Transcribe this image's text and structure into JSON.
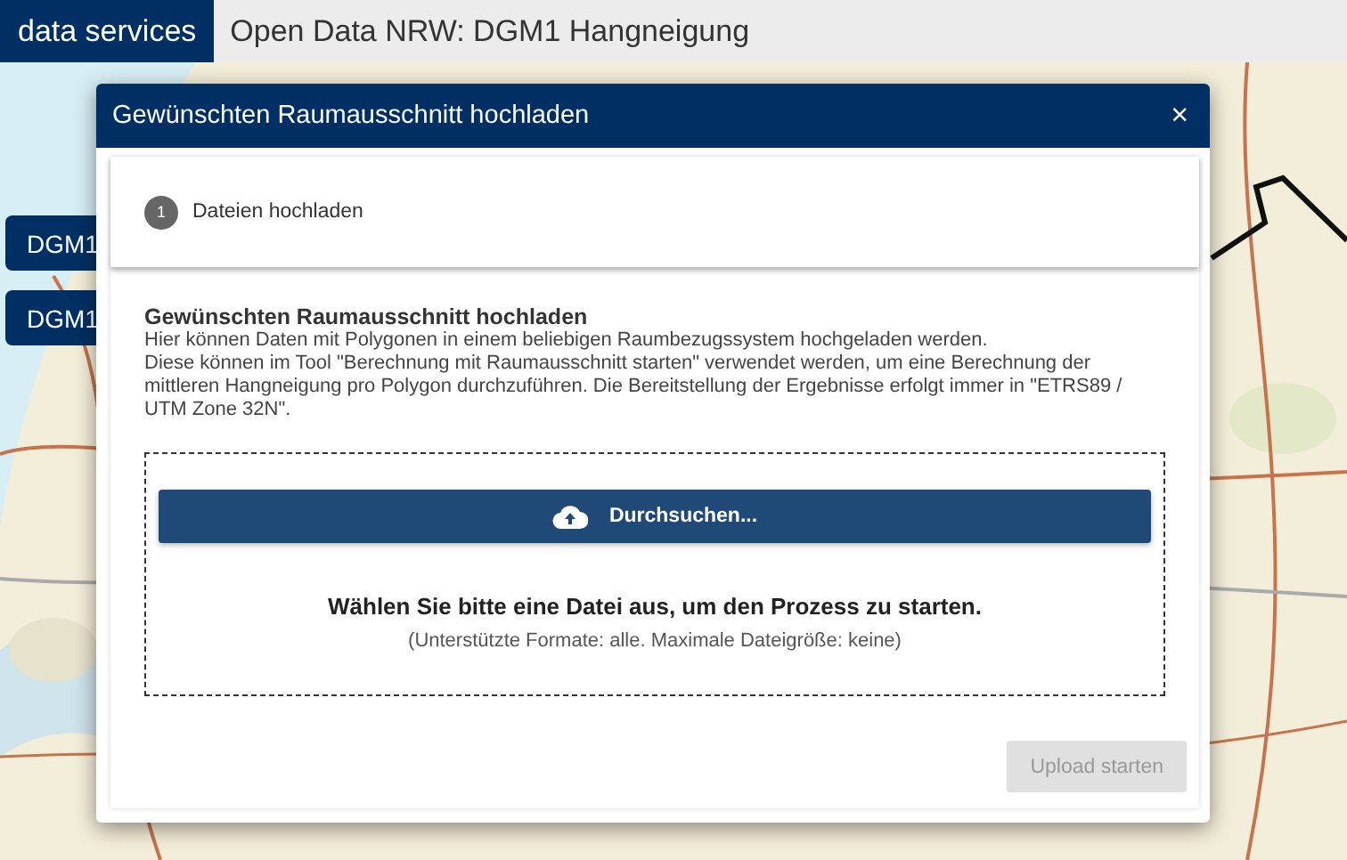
{
  "header": {
    "brand": "data services",
    "title": "Open Data NRW: DGM1 Hangneigung"
  },
  "side_buttons": [
    "DGM1",
    "DGM1"
  ],
  "dialog": {
    "title": "Gewünschten Raumausschnitt hochladen",
    "close": "×",
    "steps": [
      {
        "number": "1",
        "label": "Dateien hochladen",
        "selected": true
      }
    ],
    "heading": "Gewünschten Raumausschnitt hochladen",
    "paragraphs": [
      "Hier können Daten mit Polygonen in einem beliebigen Raumbezugssystem hochgeladen werden.",
      "Diese können im Tool \"Berechnung mit Raumausschnitt starten\" verwendet werden, um eine Berechnung der mittleren Hangneigung pro Polygon durchzuführen. Die Bereitstellung der Ergebnisse erfolgt immer in \"ETRS89 / UTM Zone 32N\"."
    ],
    "browse_button": "Durchsuchen...",
    "prompt": "Wählen Sie bitte eine Datei aus, um den Prozess zu starten.",
    "hint": "(Unterstützte Formate: alle. Maximale Dateigröße: keine)",
    "upload_button": {
      "label": "Upload starten",
      "disabled": true
    }
  }
}
